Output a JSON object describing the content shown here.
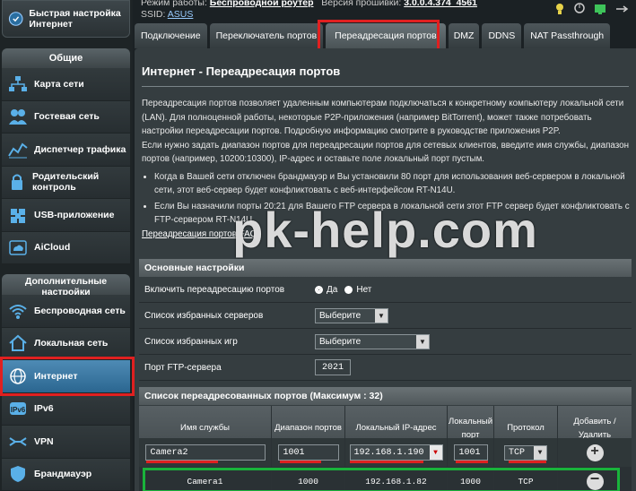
{
  "sidebar": {
    "quick_setup": "Быстрая настройка Интернет",
    "general_header": "Общие",
    "general_items": [
      {
        "label": "Карта сети",
        "icon": "network-map-icon"
      },
      {
        "label": "Гостевая сеть",
        "icon": "guest-network-icon"
      },
      {
        "label": "Диспетчер трафика",
        "icon": "traffic-manager-icon"
      },
      {
        "label": "Родительский контроль",
        "icon": "parental-control-icon"
      },
      {
        "label": "USB-приложение",
        "icon": "usb-app-icon"
      },
      {
        "label": "AiCloud",
        "icon": "aicloud-icon"
      }
    ],
    "advanced_header": "Дополнительные настройки",
    "advanced_items": [
      {
        "label": "Беспроводная сеть",
        "icon": "wireless-icon"
      },
      {
        "label": "Локальная сеть",
        "icon": "lan-icon"
      },
      {
        "label": "Интернет",
        "icon": "internet-icon"
      },
      {
        "label": "IPv6",
        "icon": "ipv6-icon"
      },
      {
        "label": "VPN",
        "icon": "vpn-icon"
      },
      {
        "label": "Брандмауэр",
        "icon": "firewall-icon"
      }
    ]
  },
  "topbar": {
    "mode_label": "Режим работы:",
    "mode_value": "Беспроводной роутер",
    "fw_label": "Версия прошивки:",
    "fw_value": "3.0.0.4.374_4561",
    "ssid_label": "SSID:",
    "ssid_value": "ASUS"
  },
  "tabs": [
    "Подключение",
    "Переключатель портов",
    "Переадресация портов",
    "DMZ",
    "DDNS",
    "NAT Passthrough"
  ],
  "page": {
    "title": "Интернет - Переадресация портов",
    "p1": "Переадресация портов позволяет удаленным компьютерам подключаться к конкретному компьютеру локальной сети (LAN). Для полноценной работы, некоторые P2P-приложения (например BitTorrent), может также потребовать настройки переадресации портов. Подробную информацию смотрите в руководстве приложения P2P.",
    "p2": "Если нужно задать диапазон портов для переадресации портов для сетевых клиентов, введите имя службы, диапазон портов (например, 10200:10300), IP-адрес и оставьте поле локальный порт пустым.",
    "bullet1": "Когда в Вашей сети отключен брандмауэр и Вы установили 80 порт для использования веб-сервером в локальной сети, этот веб-сервер будет конфликтовать с веб-интерфейсом RT-N14U.",
    "bullet2": "Если Вы назначили порты 20:21 для Вашего FTP сервера в локальной сети этот FTP сервер будет конфликтовать с FTP-сервером RT-N14U.",
    "faq": "Переадресация портов FAQ",
    "watermark": "pk-help.com"
  },
  "basic": {
    "header": "Основные настройки",
    "enable_label": "Включить переадресацию портов",
    "yes": "Да",
    "no": "Нет",
    "servers_label": "Список избранных серверов",
    "servers_value": "Выберите",
    "games_label": "Список избранных игр",
    "games_value": "Выберите",
    "ftp_label": "Порт FTP-сервера",
    "ftp_value": "2021"
  },
  "table": {
    "header": "Список переадресованных портов (Максимум : 32)",
    "columns": [
      "Имя службы",
      "Диапазон портов",
      "Локальный IP-адрес",
      "Локальный порт",
      "Протокол",
      "Добавить / Удалить"
    ],
    "input_row": {
      "name": "Camera2",
      "range": "1001",
      "ip": "192.168.1.190",
      "port": "1001",
      "proto": "TCP"
    },
    "rows": [
      {
        "name": "Camera1",
        "range": "1000",
        "ip": "192.168.1.82",
        "port": "1000",
        "proto": "TCP"
      }
    ]
  }
}
